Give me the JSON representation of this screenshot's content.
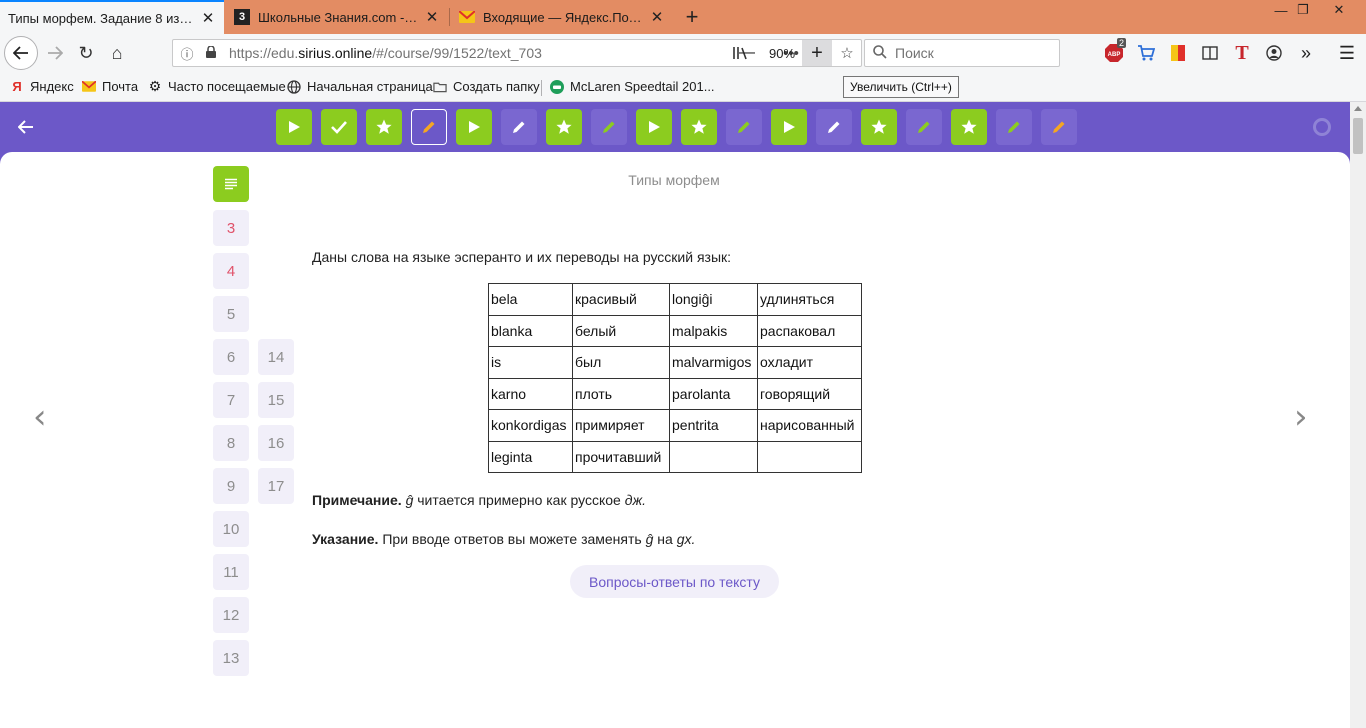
{
  "browser": {
    "tabs": [
      {
        "title": "Типы морфем. Задание 8 из 73 —",
        "favicon": "sirius-icon",
        "active": true
      },
      {
        "title": "Школьные Знания.com - Реш",
        "favicon": "znania-icon",
        "favicon_text": "3",
        "active": false
      },
      {
        "title": "Входящие — Яндекс.Почта",
        "favicon": "mail-icon",
        "active": false
      }
    ],
    "url_prefix": "https://edu.",
    "url_host": "sirius.online",
    "url_path": "/#/course/99/1522/text_703",
    "zoom": "90%",
    "search_placeholder": "Поиск",
    "abp_badge": "2",
    "bookmarks": [
      {
        "label": "Яндекс",
        "icon": "yandex-icon"
      },
      {
        "label": "Почта",
        "icon": "mail-icon"
      },
      {
        "label": "Часто посещаемые",
        "icon": "gear-icon"
      },
      {
        "label": "Начальная страница",
        "icon": "globe-icon"
      },
      {
        "label": "Создать папку",
        "icon": "folder-icon"
      },
      {
        "label": "McLaren Speedtail 201...",
        "icon": "car-icon"
      }
    ],
    "tooltip": "Увеличить (Ctrl++)"
  },
  "steps": [
    {
      "kind": "video",
      "state": "done"
    },
    {
      "kind": "check",
      "state": "done"
    },
    {
      "kind": "star",
      "state": "done"
    },
    {
      "kind": "pencil",
      "state": "current"
    },
    {
      "kind": "video",
      "state": "done"
    },
    {
      "kind": "pencil",
      "state": "todo"
    },
    {
      "kind": "star",
      "state": "done"
    },
    {
      "kind": "pencil",
      "state": "todo-green"
    },
    {
      "kind": "video",
      "state": "done"
    },
    {
      "kind": "star",
      "state": "done"
    },
    {
      "kind": "pencil",
      "state": "todo-green"
    },
    {
      "kind": "video",
      "state": "done"
    },
    {
      "kind": "pencil",
      "state": "todo"
    },
    {
      "kind": "star",
      "state": "done"
    },
    {
      "kind": "pencil",
      "state": "todo-green"
    },
    {
      "kind": "star",
      "state": "done"
    },
    {
      "kind": "pencil",
      "state": "todo-green"
    },
    {
      "kind": "pencil",
      "state": "todo-orange"
    }
  ],
  "lesson": {
    "title": "Типы морфем",
    "intro": "Даны слова на языке эсперанто и их переводы на русский язык:",
    "table": [
      [
        "bela",
        "красивый",
        "longiĝi",
        "удлиняться"
      ],
      [
        "blanka",
        "белый",
        "malpakis",
        "распаковал"
      ],
      [
        "is",
        "был",
        "malvarmigos",
        "охладит"
      ],
      [
        "karno",
        "плоть",
        "parolanta",
        "говорящий"
      ],
      [
        "konkordigas",
        "примиряет",
        "pentrita",
        "нарисованный"
      ],
      [
        "leginta",
        "прочитавший",
        "",
        ""
      ]
    ],
    "note_label": "Примечание.",
    "note_letter": "ĝ",
    "note_text": " читается примерно как русское ",
    "note_sound": "дж.",
    "hint_label": "Указание.",
    "hint_text": " При вводе ответов вы можете заменять ",
    "hint_letter": "ĝ",
    "hint_mid": " на ",
    "hint_repl": "gx.",
    "qa_button": "Вопросы-ответы по тексту"
  },
  "questions_left": [
    {
      "label": "3",
      "red": true
    },
    {
      "label": "4",
      "red": true
    },
    {
      "label": "5",
      "red": false
    },
    {
      "label": "6",
      "red": false
    },
    {
      "label": "7",
      "red": false
    },
    {
      "label": "8",
      "red": false
    },
    {
      "label": "9",
      "red": false
    },
    {
      "label": "10",
      "red": false
    },
    {
      "label": "11",
      "red": false
    },
    {
      "label": "12",
      "red": false
    },
    {
      "label": "13",
      "red": false
    }
  ],
  "questions_right": [
    {
      "label": "14"
    },
    {
      "label": "15"
    },
    {
      "label": "16"
    },
    {
      "label": "17"
    }
  ],
  "colors": {
    "brand_purple": "#6c58c8",
    "done_green": "#8ccc1f",
    "tile_bg": "#f1eff9",
    "red_number": "#e0526a",
    "firefox_tabbar": "#e38c63"
  }
}
